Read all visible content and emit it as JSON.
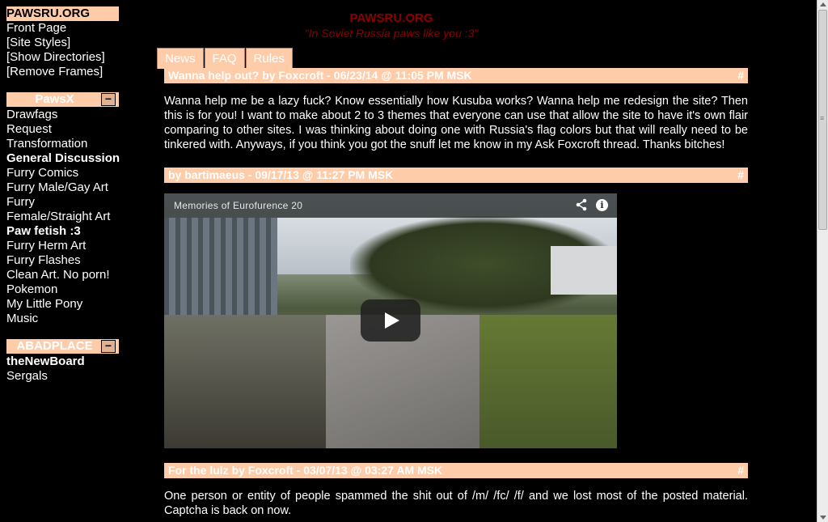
{
  "sidebar": {
    "site_header": "PAWSRU.ORG",
    "site_links": [
      "Front Page",
      "[Site Styles]",
      "[Show Directories]",
      "[Remove Frames]"
    ],
    "sections": [
      {
        "title": "PawsX",
        "collapse_label": "−",
        "boards": [
          {
            "label": "Drawfags",
            "bold": false
          },
          {
            "label": "Request",
            "bold": false
          },
          {
            "label": "Transformation",
            "bold": false
          },
          {
            "label": "General Discussion",
            "bold": true
          },
          {
            "label": "Furry Comics",
            "bold": false
          },
          {
            "label": "Furry Male/Gay Art",
            "bold": false
          },
          {
            "label": "Furry",
            "bold": false
          },
          {
            "label": "Female/Straight Art",
            "bold": false
          },
          {
            "label": "Paw fetish :3",
            "bold": true
          },
          {
            "label": "Furry Herm Art",
            "bold": false
          },
          {
            "label": "Furry Flashes",
            "bold": false
          },
          {
            "label": "Clean Art. No porn!",
            "bold": false
          },
          {
            "label": "Pokemon",
            "bold": false
          },
          {
            "label": "My Little Pony",
            "bold": false
          },
          {
            "label": "Music",
            "bold": false
          }
        ]
      },
      {
        "title": "ABADPLACE",
        "collapse_label": "−",
        "boards": [
          {
            "label": "theNewBoard",
            "bold": true
          },
          {
            "label": "Sergals",
            "bold": false
          }
        ]
      }
    ]
  },
  "main": {
    "site_title": "PAWSRU.ORG",
    "slogan": "\"In Soviet Russia paws like you :3\"",
    "tabs": [
      {
        "label": "News",
        "active": true
      },
      {
        "label": "FAQ",
        "active": false
      },
      {
        "label": "Rules",
        "active": false
      }
    ],
    "posts": [
      {
        "header": "Wanna help out? by Foxcroft - 06/23/14 @ 11:05 PM MSK",
        "anchor": "#",
        "body": "Wanna help me be a lazy fuck? Know essentially how Kusuba works? Wanna help me redesign the site? Then this is for you! I want to make about 2 to 3 themes that everyone can use that allow the site to have it's own flair comparing to other sites. I was thinking about doing one with Russia's flag colors but that will really need to be tinkered with. Anyways, if you think you got the snuff let me know in my Ask Foxcroft thread. Thanks bitches!"
      },
      {
        "header": "by bartimaeus - 09/17/13 @ 11:27 PM MSK",
        "anchor": "#",
        "video_title": "Memories of Eurofurence 20",
        "video_share_icon": "share-icon",
        "video_info_icon": "info-icon",
        "video_info_glyph": "i"
      },
      {
        "header": "For the lulz by Foxcroft - 03/07/13 @ 03:27 AM MSK",
        "anchor": "#",
        "body": "One person or entity of people spammed the shit out of /m/ /fc/ /f/ and we lost most of the posted material. Captcha is back on now."
      }
    ]
  },
  "colors": {
    "accent": "#ffccaa",
    "title_red": "#8b0000",
    "background": "#000000"
  }
}
